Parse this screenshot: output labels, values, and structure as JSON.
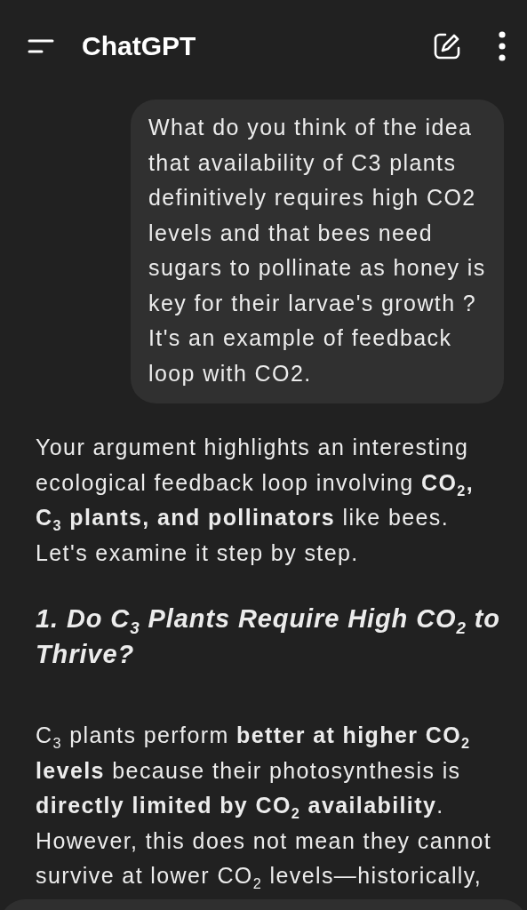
{
  "header": {
    "title": "ChatGPT"
  },
  "messages": [
    {
      "kind": "user",
      "text": "What do you think of the idea that availability of C3 plants definitively requires high CO2 levels and that bees need sugars to pollinate as honey is key for their larvae's growth ? It's an example of feedback loop with CO2."
    },
    {
      "kind": "assistant",
      "blocks": [
        {
          "kind": "paragraph",
          "text": "Your argument highlights an interesting ecological feedback loop involving **CO$_{2}$, C$_{3}$ plants, and pollinators** like bees. Let's examine it step by step."
        },
        {
          "kind": "heading",
          "text": "1. Do C$_{3}$ Plants Require High CO$_{2}$ to Thrive?"
        },
        {
          "kind": "paragraph",
          "text": "C$_{3}$ plants perform **better at higher CO$_{2}$ levels** because their photosynthesis is **directly limited by CO$_{2}$ availability**. However, this does not mean they cannot survive at lower CO$_{2}$ levels—historically,"
        }
      ]
    }
  ]
}
